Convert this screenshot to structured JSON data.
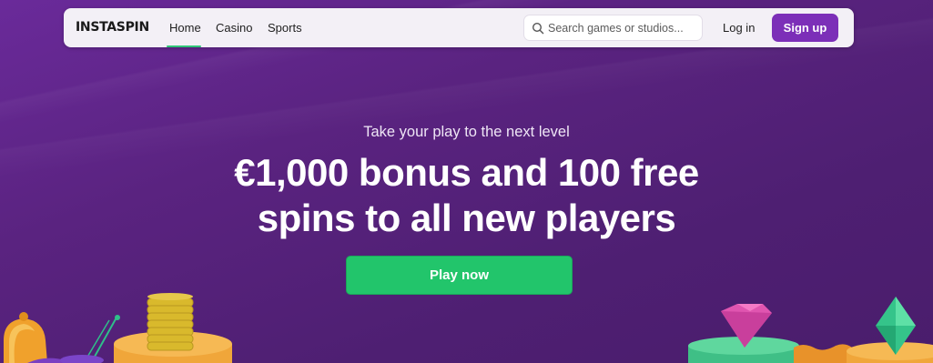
{
  "nav": {
    "logo": "INSTASPIN",
    "links": [
      "Home",
      "Casino",
      "Sports"
    ],
    "active": "Home",
    "search_placeholder": "Search games or studios...",
    "login_label": "Log in",
    "signup_label": "Sign up"
  },
  "hero": {
    "tagline": "Take your play to the next level",
    "headline_line1": "€1,000 bonus and 100 free",
    "headline_line2": "spins to all new players",
    "cta_label": "Play now"
  },
  "colors": {
    "background": "#5a2380",
    "navbar": "#f3f0f6",
    "signup_button": "#7c2fb8",
    "cta_button": "#22c56b",
    "active_underline": "#2fc578"
  }
}
